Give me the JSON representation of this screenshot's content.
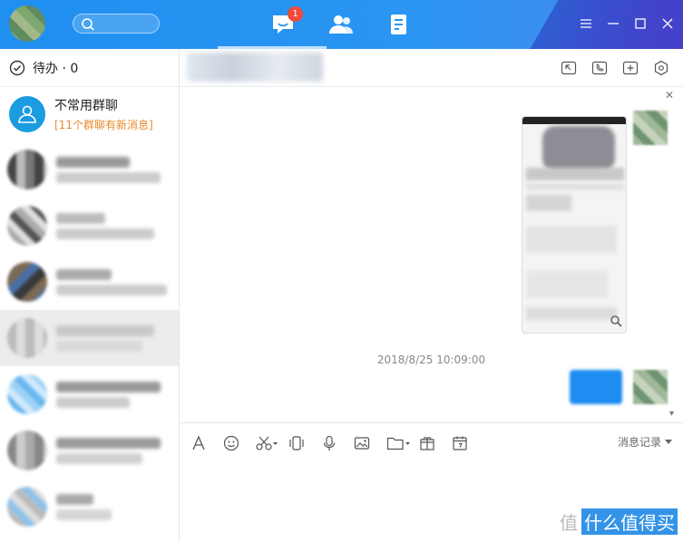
{
  "topbar": {
    "search_placeholder": "",
    "message_badge": "1",
    "tabs": [
      "messages-tab",
      "contacts-tab",
      "docs-tab"
    ]
  },
  "sidebar": {
    "todo_label": "待办 · 0",
    "group_title": "不常用群聊",
    "group_subtitle": "[11个群聊有新消息]"
  },
  "chat": {
    "timestamp": "2018/8/25 10:09:00",
    "history_label": "消息记录"
  },
  "watermark": {
    "logo_text": "值",
    "text": "什么值得买"
  },
  "colors": {
    "brand_blue": "#1f8ff0",
    "badge_red": "#f04a3b",
    "notice_orange": "#e88a2a"
  }
}
